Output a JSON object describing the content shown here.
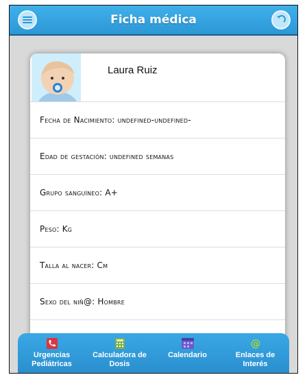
{
  "header": {
    "title": "Ficha médica",
    "menu_icon": "hamburger-icon",
    "back_icon": "back-arrow-icon",
    "color": "#2c97d6"
  },
  "profile": {
    "name": "Laura Ruiz",
    "avatar_icon": "baby-avatar"
  },
  "fields": [
    "Fecha de Nacimiento: undefined-undefined-",
    "Edad de gestación: undefined semanas",
    "Grupo sanguíneo: A+",
    "Peso: Kg",
    "Talla al nacer: Cm",
    "Sexo del niñ@: Hombre"
  ],
  "tabs": [
    {
      "label": "Urgencias Pediátricas",
      "icon": "phone-icon",
      "color": "#d9363e"
    },
    {
      "label": "Calculadora de Dosis",
      "icon": "calculator-icon",
      "color": "#7fb04b"
    },
    {
      "label": "Calendario",
      "icon": "calendar-icon",
      "color": "#6a5acd"
    },
    {
      "label": "Enlaces de Interés",
      "icon": "at-icon",
      "color": "#a5d63b"
    }
  ]
}
